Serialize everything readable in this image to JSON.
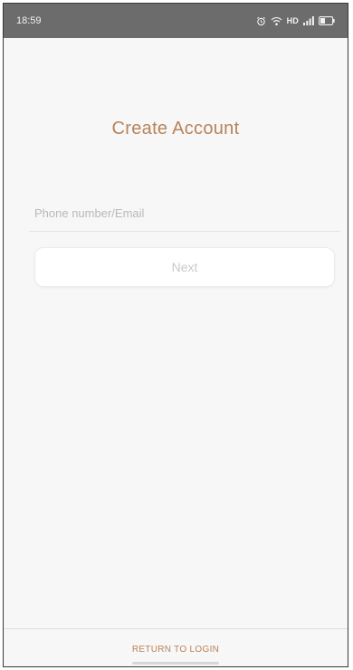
{
  "status_bar": {
    "time": "18:59",
    "icons": [
      "alarm-icon",
      "wifi-icon",
      "hd-badge",
      "signal-icon",
      "battery-icon"
    ],
    "hd_label": "HD",
    "background": "#6c6c6c"
  },
  "screen": {
    "title": "Create Account",
    "accent_color": "#b8835a"
  },
  "form": {
    "account_input": {
      "placeholder": "Phone number/Email",
      "value": ""
    },
    "next_button_label": "Next"
  },
  "footer": {
    "return_label": "RETURN TO LOGIN"
  }
}
